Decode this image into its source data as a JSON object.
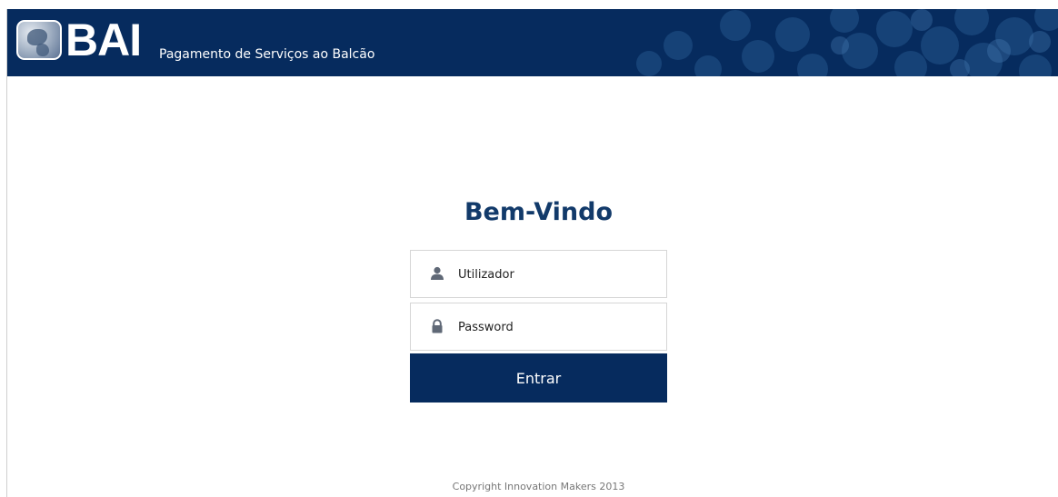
{
  "header": {
    "logo_text": "BAI",
    "title": "Pagamento de Serviços ao Balcão"
  },
  "login": {
    "heading": "Bem-Vindo",
    "username_placeholder": "Utilizador",
    "password_placeholder": "Password",
    "submit_label": "Entrar",
    "username_icon": "user-icon",
    "password_icon": "lock-icon"
  },
  "footer": {
    "copyright": "Copyright Innovation Makers 2013"
  },
  "colors": {
    "brand_navy": "#062b5e",
    "heading_blue": "#123a6a",
    "field_border": "#d6d6d6",
    "icon_gray": "#5f6876"
  }
}
